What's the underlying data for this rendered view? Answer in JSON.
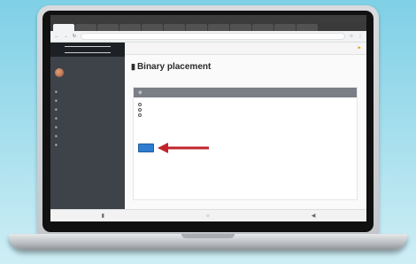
{
  "status_bar": {
    "left": "",
    "right": ""
  },
  "tabs": [
    {
      "label": ""
    },
    {
      "label": ""
    },
    {
      "label": ""
    },
    {
      "label": ""
    },
    {
      "label": ""
    },
    {
      "label": ""
    },
    {
      "label": ""
    },
    {
      "label": ""
    },
    {
      "label": ""
    },
    {
      "label": ""
    },
    {
      "label": ""
    },
    {
      "label": ""
    }
  ],
  "browser": {
    "url": ""
  },
  "sidebar": {
    "brand": "",
    "top_link": "",
    "user_label": "",
    "user_name": "",
    "items": [
      {
        "label": ""
      },
      {
        "label": ""
      },
      {
        "label": ""
      },
      {
        "label": ""
      },
      {
        "label": ""
      },
      {
        "label": ""
      },
      {
        "label": ""
      }
    ]
  },
  "topnav": {
    "link1": "",
    "link2": ""
  },
  "page": {
    "title": "Binary placement"
  },
  "question": {
    "header": "",
    "options": [
      {
        "label": ""
      },
      {
        "label": ""
      },
      {
        "label": ""
      }
    ],
    "save_label": ""
  },
  "colors": {
    "accent": "#2f7dd0",
    "arrow": "#c0242b",
    "sidebar": "#3e434a"
  }
}
